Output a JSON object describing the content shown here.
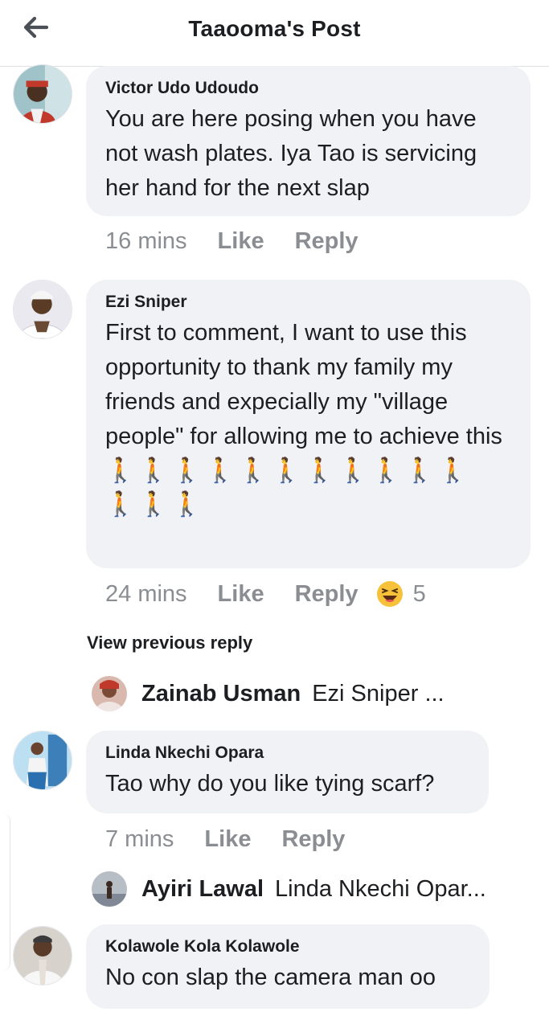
{
  "header": {
    "title": "Taaooma's Post",
    "back_icon": "arrow-left-icon"
  },
  "comments": [
    {
      "author": "Victor Udo Udoudo",
      "text": "You are here posing when you have not wash plates. Iya Tao is servicing her hand for the next slap",
      "time": "16 mins",
      "like": "Like",
      "reply": "Reply"
    },
    {
      "author": "Ezi Sniper",
      "text": "First to comment, I want to use this opportunity to thank my family my friends and expecially my \"village people\" for allowing me to achieve this",
      "emoji_row_1": "🚶🚶🚶🚶🚶🚶🚶🚶🚶🚶🚶",
      "emoji_row_2": "🚶🚶🚶",
      "time": "24 mins",
      "like": "Like",
      "reply": "Reply",
      "reaction_icon": "laughing-emoji-icon",
      "reaction_count": "5",
      "view_previous": "View previous reply",
      "reply_preview": {
        "name": "Zainab Usman",
        "snippet": "Ezi Sniper ..."
      }
    },
    {
      "author": "Linda Nkechi Opara",
      "text": "Tao why do you like tying scarf?",
      "time": "7 mins",
      "like": "Like",
      "reply": "Reply",
      "reply_preview": {
        "name": "Ayiri Lawal",
        "snippet": "Linda Nkechi Opar..."
      }
    },
    {
      "author": "Kolawole Kola Kolawole",
      "text": "No con slap the camera man oo"
    }
  ]
}
